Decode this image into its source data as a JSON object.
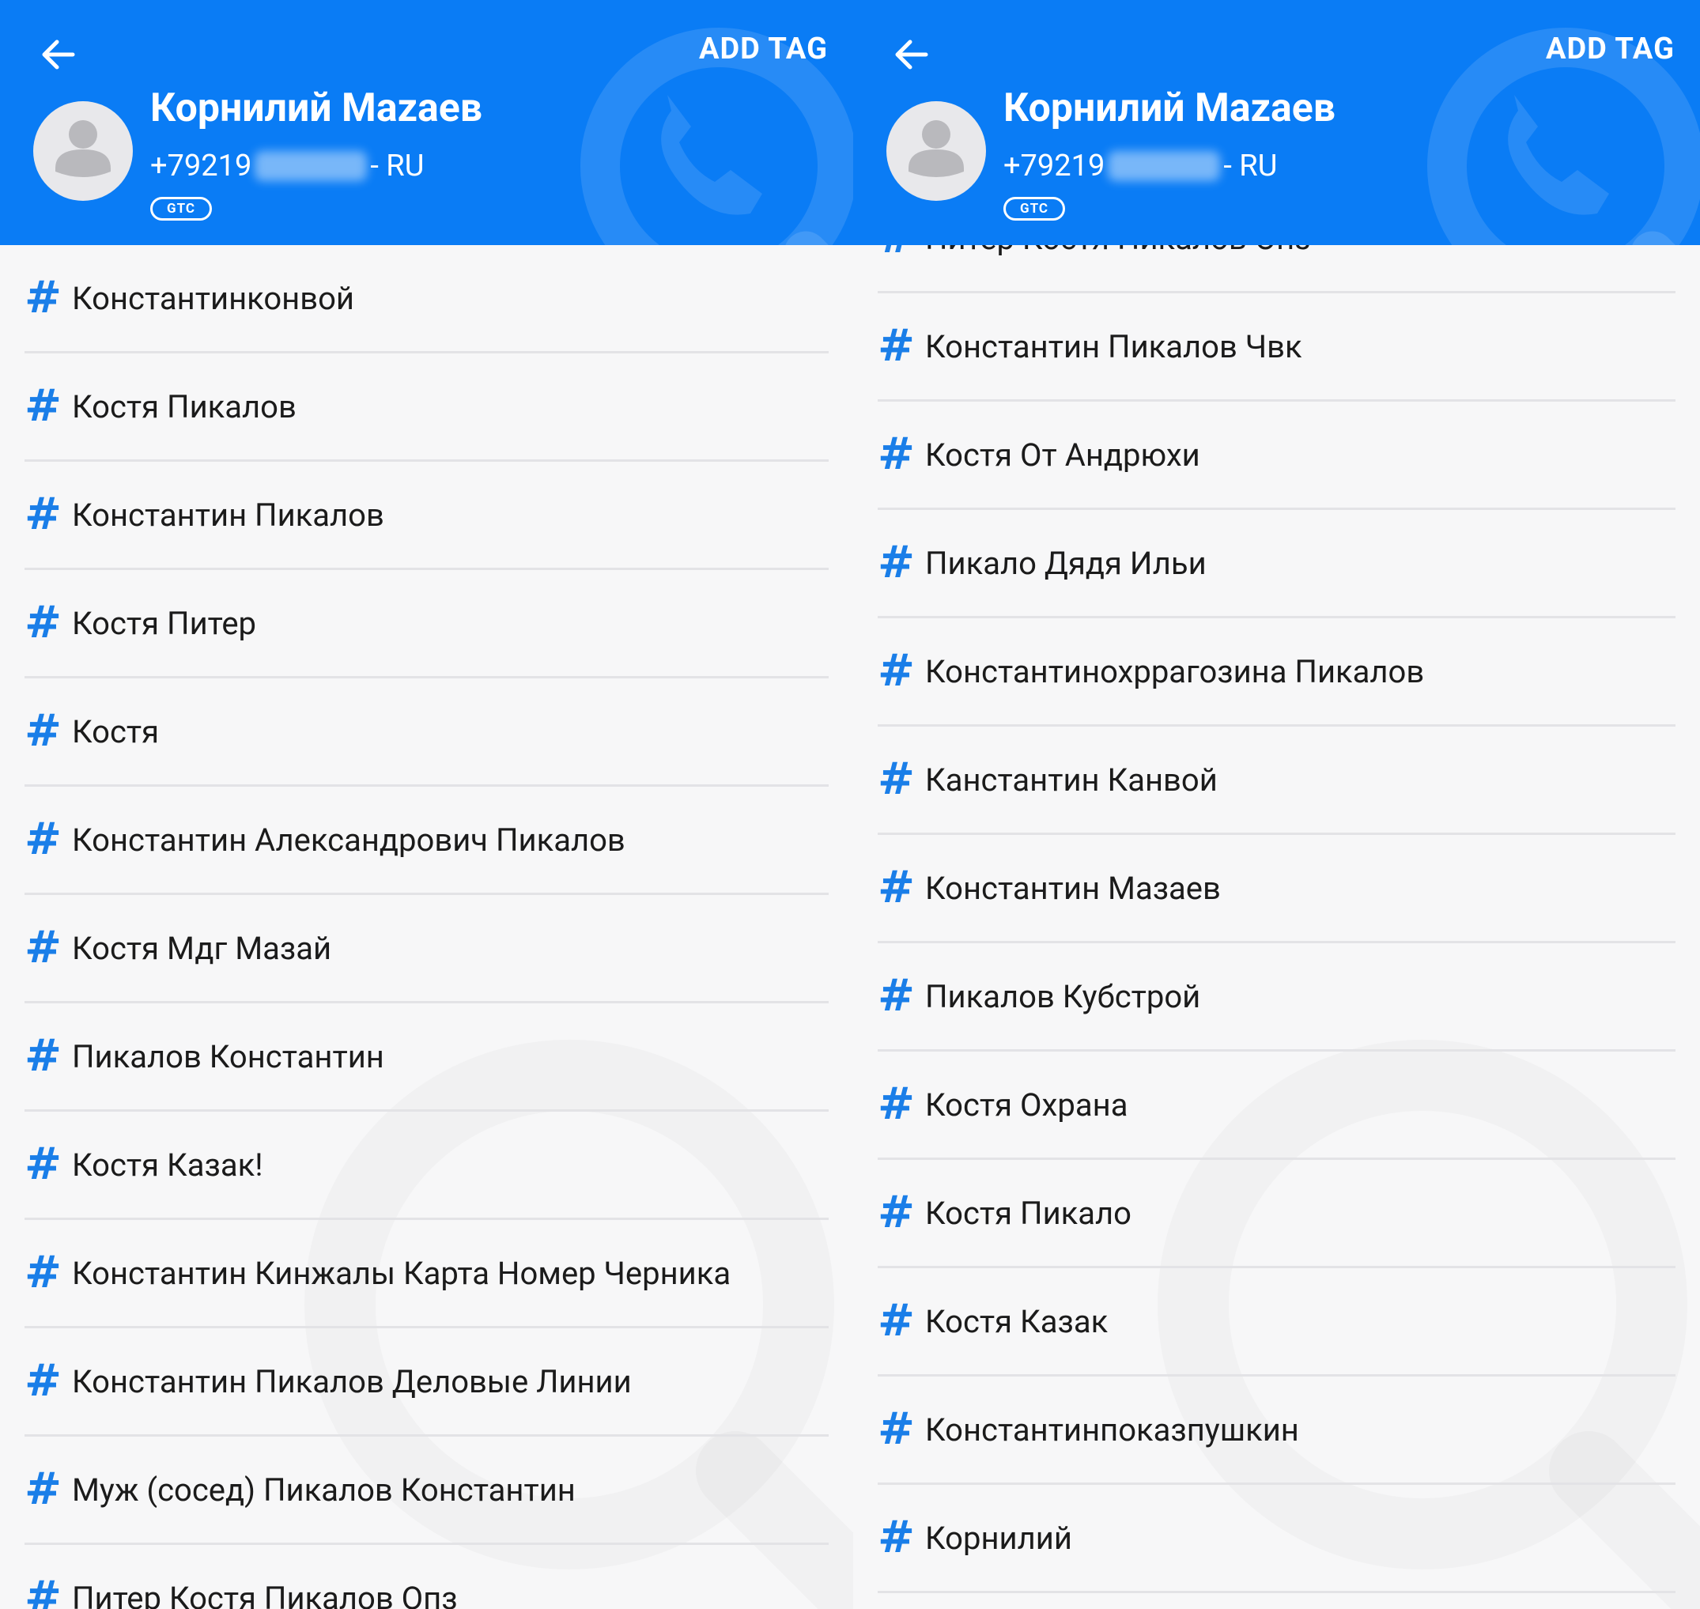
{
  "header": {
    "contact_name": "Корнилий Mazaeв",
    "phone_prefix": "+79219",
    "phone_suffix": "- RU",
    "operator_badge": "GTC",
    "add_tag_label": "ADD TAG"
  },
  "left_tags": [
    "Константинконвой",
    "Костя Пикалов",
    "Константин Пикалов",
    "Костя Питер",
    "Костя",
    "Константин Александрович Пикалов",
    "Костя Мдг Мазай",
    "Пикалов Константин",
    "Костя Казак!",
    "Константин Кинжалы Карта Номер Черника",
    "Константин Пикалов Деловые Линии",
    "Муж (сосед) Пикалов Константин",
    "Питер Костя Пикалов Опз"
  ],
  "right_tags": [
    "Питер Костя Пикалов Опз",
    "Константин Пикалов Чвк",
    "Костя От Андрюхи",
    "Пикало Дядя Ильи",
    "Константинохррагозина Пикалов",
    "Канстантин Канвой",
    "Константин Мазаев",
    "Пикалов Кубстрой",
    "Костя Охрана",
    "Костя Пикало",
    "Костя Казак",
    "Константинпоказпушкин",
    "Корнилий"
  ],
  "tag_symbol": "#",
  "colors": {
    "header_blue": "#0a7cf5",
    "hash_blue": "#1a7ee8",
    "text": "#1b1b1b",
    "divider": "#e3e3e6"
  },
  "icons": [
    "back-arrow-icon",
    "avatar-placeholder-icon",
    "phone-search-logo-icon"
  ]
}
